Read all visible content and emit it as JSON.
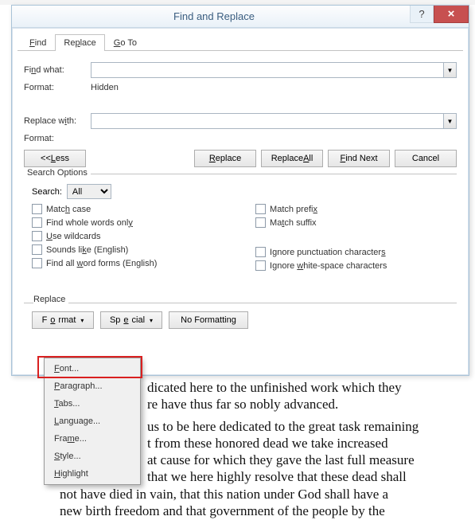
{
  "title": "Find and Replace",
  "tabs": {
    "find": "Find",
    "replace": "Replace",
    "goto": "Go To"
  },
  "labels": {
    "findWhat": "Find what:",
    "format1": "Format:",
    "formatValue": "Hidden",
    "replaceWith": "Replace with:",
    "format2": "Format:"
  },
  "fields": {
    "findWhatValue": "",
    "replaceWithValue": ""
  },
  "buttons": {
    "less": "<<  Less",
    "replace": "Replace",
    "replaceAll": "Replace All",
    "findNext": "Find Next",
    "cancel": "Cancel",
    "format": "Format",
    "special": "Special",
    "noFormatting": "No Formatting"
  },
  "optionsLegend": "Search Options",
  "search": {
    "label": "Search:",
    "value": "All"
  },
  "checks": {
    "matchCase": "Match case",
    "wholeWords": "Find whole words only",
    "wildcards": "Use wildcards",
    "soundsLike": "Sounds like (English)",
    "wordForms": "Find all word forms (English)",
    "matchPrefix": "Match prefix",
    "matchSuffix": "Match suffix",
    "ignorePunct": "Ignore punctuation characters",
    "ignoreWhite": "Ignore white-space characters"
  },
  "replaceSection": "Replace",
  "menu": {
    "font": "Font...",
    "paragraph": "Paragraph...",
    "tabs": "Tabs...",
    "language": "Language...",
    "frame": "Frame...",
    "style": "Style...",
    "highlight": "Highlight"
  },
  "docText": {
    "p1a": "dicated here to the unfinished work which they",
    "p1b": "re have thus far so nobly advanced.",
    "p2a": "us to be here dedicated to the great task remaining",
    "p2b": "t from these honored dead we take increased",
    "p2c": "at cause for which they gave the last full measure",
    "p2d": "that we here highly resolve that these dead shall",
    "p2e": "not have died in vain, that this nation under God shall have a",
    "p2f": "new birth freedom  and that government of the people  by the"
  }
}
